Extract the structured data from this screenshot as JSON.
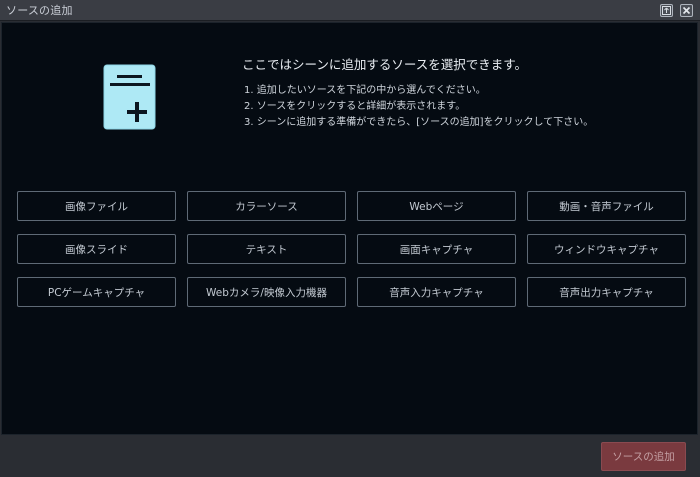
{
  "window": {
    "title": "ソースの追加",
    "controls": [
      "restore-icon",
      "close-icon"
    ]
  },
  "intro": {
    "heading": "ここではシーンに追加するソースを選択できます。",
    "steps": [
      "1. 追加したいソースを下記の中から選んでください。",
      "2. ソースをクリックすると詳細が表示されます。",
      "3. シーンに追加する準備ができたら、[ソースの追加]をクリックして下さい。"
    ],
    "icon": "add-source-document-icon"
  },
  "sources": [
    "画像ファイル",
    "カラーソース",
    "Webページ",
    "動画・音声ファイル",
    "画像スライド",
    "テキスト",
    "画面キャプチャ",
    "ウィンドウキャプチャ",
    "PCゲームキャプチャ",
    "Webカメラ/映像入力機器",
    "音声入力キャプチャ",
    "音声出力キャプチャ"
  ],
  "footer": {
    "add_label": "ソースの追加"
  },
  "colors": {
    "background": "#050b12",
    "chrome": "#2a2d33",
    "icon": "#aee9f5",
    "add_button": "#7a3a3f"
  }
}
